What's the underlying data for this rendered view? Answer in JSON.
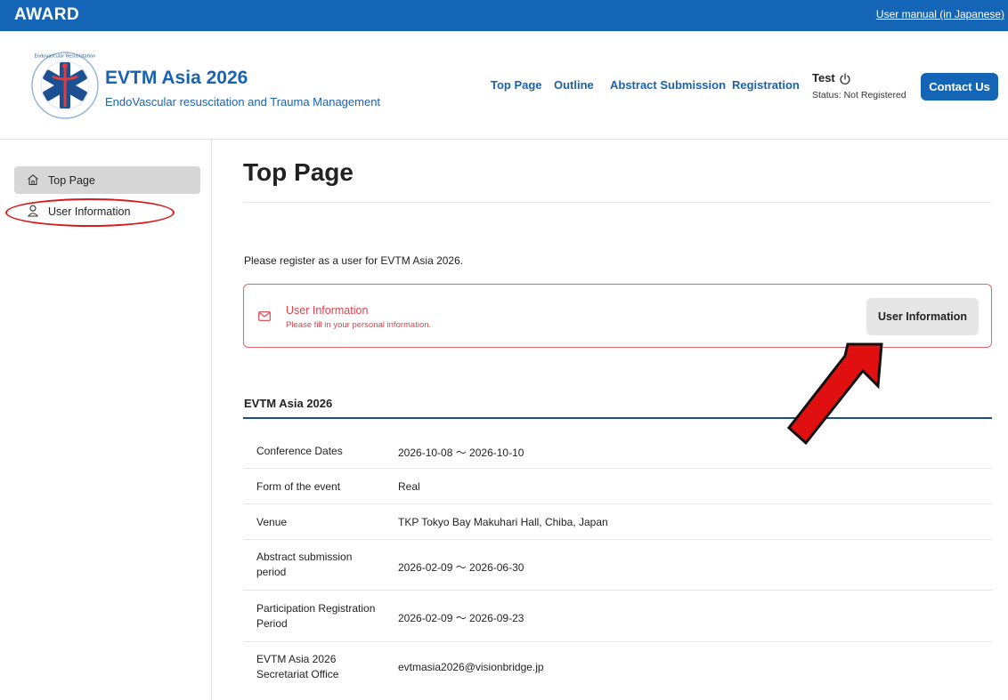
{
  "topbar": {
    "brand": "AWARD",
    "manual_link": "User manual (in Japanese)"
  },
  "header": {
    "logo_icon": "evtm-asia-logo",
    "title": "EVTM Asia 2026",
    "subtitle": "EndoVascular resuscitation and Trauma Management",
    "nav": [
      "Top Page",
      "Outline",
      "Abstract Submission",
      "Registration"
    ],
    "user_name": "Test",
    "user_status": "Status: Not Registered",
    "contact_label": "Contact Us"
  },
  "sidebar": {
    "items": [
      {
        "label": "Top Page",
        "icon": "home-icon",
        "active": true
      },
      {
        "label": "User Information",
        "icon": "user-icon",
        "active": false
      }
    ]
  },
  "main": {
    "title": "Top Page",
    "intro": "Please register as a user for EVTM Asia 2026.",
    "alert": {
      "title": "User Information",
      "message": "Please fill in your personal information.",
      "button": "User Information",
      "icon": "mail-icon"
    },
    "section_title": "EVTM Asia 2026",
    "rows": [
      {
        "key": "Conference Dates",
        "value": "2026-10-08 ～ 2026-10-10"
      },
      {
        "key": "Form of the event",
        "value": "Real"
      },
      {
        "key": "Venue",
        "value": "TKP Tokyo Bay Makuhari Hall, Chiba, Japan"
      },
      {
        "key": "Abstract submission period",
        "value": "2026-02-09 ～ 2026-06-30"
      },
      {
        "key": "Participation Registration Period",
        "value": "2026-02-09 ～ 2026-09-23"
      },
      {
        "key": "EVTM Asia 2026 Secretariat Office",
        "value": "evtmasia2026@visionbridge.jp"
      }
    ]
  },
  "colors": {
    "brand": "#1565b6",
    "alert": "#e0414c",
    "annotation": "#d91a1a"
  }
}
